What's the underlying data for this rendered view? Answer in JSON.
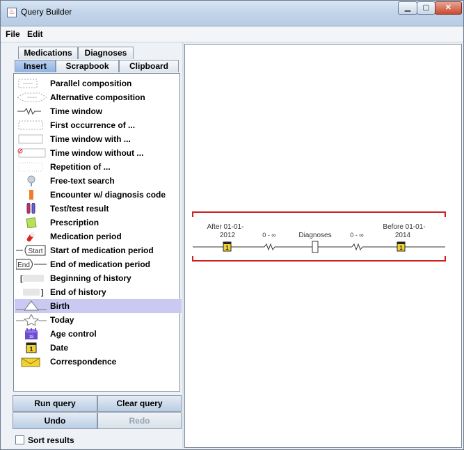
{
  "window": {
    "title": "Query Builder",
    "icon": "java-app-icon"
  },
  "menu": {
    "items": [
      "File",
      "Edit"
    ]
  },
  "tabs": {
    "top_row": [
      "Medications",
      "Diagnoses"
    ],
    "bottom_row": [
      "Insert",
      "Scrapbook",
      "Clipboard"
    ],
    "active": "Insert"
  },
  "palette": {
    "items": [
      {
        "label": "Parallel composition",
        "icon": "parallel-composition-icon"
      },
      {
        "label": "Alternative composition",
        "icon": "alternative-composition-icon"
      },
      {
        "label": "Time window",
        "icon": "time-window-icon"
      },
      {
        "label": "First occurrence of ...",
        "icon": "first-occurrence-icon"
      },
      {
        "label": "Time window with ...",
        "icon": "time-window-with-icon"
      },
      {
        "label": "Time window without ...",
        "icon": "time-window-without-icon"
      },
      {
        "label": "Repetition of ...",
        "icon": "repetition-icon"
      },
      {
        "label": "Free-text search",
        "icon": "free-text-search-icon"
      },
      {
        "label": "Encounter w/ diagnosis code",
        "icon": "encounter-icon"
      },
      {
        "label": "Test/test result",
        "icon": "test-tube-icon"
      },
      {
        "label": "Prescription",
        "icon": "prescription-icon"
      },
      {
        "label": "Medication period",
        "icon": "pill-icon"
      },
      {
        "label": "Start of medication period",
        "icon": "start-medication-icon",
        "icon_text": "Start"
      },
      {
        "label": "End of medication period",
        "icon": "end-medication-icon",
        "icon_text": "End"
      },
      {
        "label": "Beginning of history",
        "icon": "beginning-history-icon",
        "icon_text": "["
      },
      {
        "label": "End of history",
        "icon": "end-history-icon",
        "icon_text": "]"
      },
      {
        "label": "Birth",
        "icon": "birth-triangle-icon",
        "selected": true
      },
      {
        "label": "Today",
        "icon": "today-star-icon"
      },
      {
        "label": "Age control",
        "icon": "age-control-icon",
        "icon_text": "18"
      },
      {
        "label": "Date",
        "icon": "calendar-date-icon",
        "icon_text": "1"
      },
      {
        "label": "Correspondence",
        "icon": "envelope-icon"
      }
    ]
  },
  "buttons": {
    "run_query": "Run query",
    "clear_query": "Clear query",
    "undo": "Undo",
    "redo": "Redo"
  },
  "sort_results": {
    "label": "Sort results",
    "checked": false
  },
  "query": {
    "after_label_line1": "After 01-01-",
    "after_label_line2": "2012",
    "gap1": "0 - ∞",
    "diagnoses_label": "Diagnoses",
    "gap2": "0 - ∞",
    "before_label_line1": "Before 01-01-",
    "before_label_line2": "2014",
    "date_icon_text": "1"
  },
  "colors": {
    "selection": "#c9c9f2",
    "bracket_red": "#cc1f1f",
    "date_icon_yellow": "#f2d233",
    "tab_active": "#9fbfe6"
  }
}
